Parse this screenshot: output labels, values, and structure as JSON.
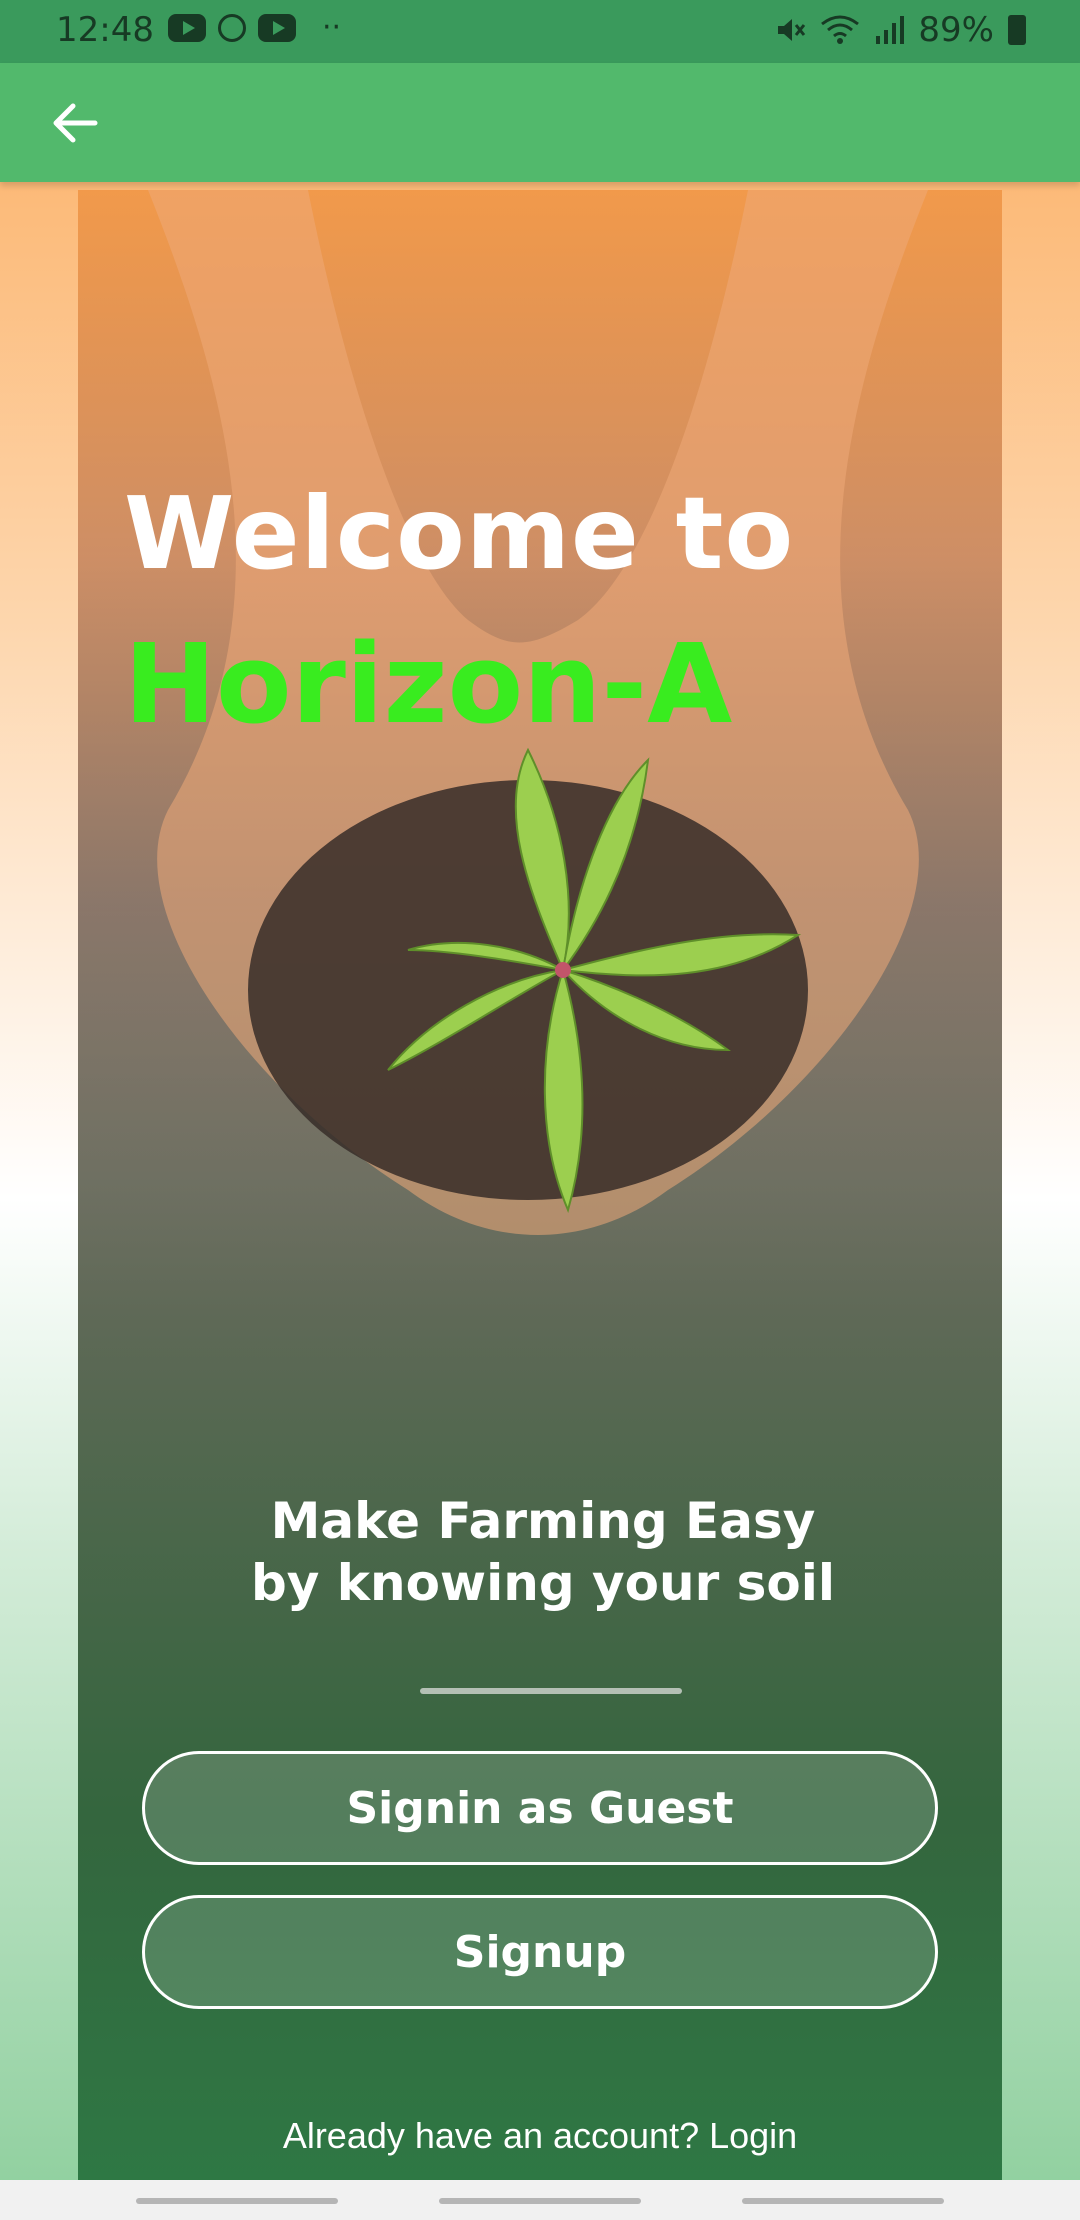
{
  "status_bar": {
    "time": "12:48",
    "battery": "89%",
    "left_icons": [
      "youtube-icon",
      "circle-icon",
      "youtube-icon",
      "more-dots-icon"
    ],
    "right_icons": [
      "mute-icon",
      "wifi-icon",
      "signal-icon",
      "battery-icon"
    ]
  },
  "app_bar": {
    "back_icon": "arrow-left-icon"
  },
  "hero": {
    "welcome": "Welcome to",
    "brand": "Horizon-A",
    "tagline": "Make Farming Easy by knowing your soil"
  },
  "actions": {
    "guest_label": "Signin as Guest",
    "signup_label": "Signup",
    "login_prompt": "Already have an account? Login"
  },
  "colors": {
    "app_bar": "#52b96c",
    "status_bar": "#3a9a5c",
    "brand": "#39ec1f"
  }
}
